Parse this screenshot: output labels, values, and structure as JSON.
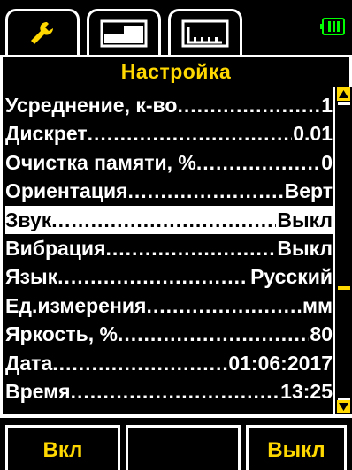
{
  "tabs": [
    {
      "name": "settings",
      "icon": "wrench-icon",
      "active": true
    },
    {
      "name": "display",
      "icon": "bars-display-icon",
      "active": false
    },
    {
      "name": "chart",
      "icon": "histogram-icon",
      "active": false
    }
  ],
  "battery": {
    "icon": "battery-icon",
    "color": "#00ff00"
  },
  "title": "Настройка",
  "menu": [
    {
      "label": "Усреднение, к-во",
      "value": "1"
    },
    {
      "label": "Дискрет",
      "value": "0.01"
    },
    {
      "label": "Очистка памяти, %",
      "value": "0"
    },
    {
      "label": "Ориентация",
      "value": "Верт"
    },
    {
      "label": "Звук",
      "value": "Выкл"
    },
    {
      "label": "Вибрация",
      "value": "Выкл"
    },
    {
      "label": "Язык",
      "value": "Русский"
    },
    {
      "label": "Ед.измерения",
      "value": " мм"
    },
    {
      "label": "Яркость, %",
      "value": "80"
    },
    {
      "label": "Дата",
      "value": "01:06:2017"
    },
    {
      "label": "Время",
      "value": "13:25"
    }
  ],
  "selected_index": 4,
  "scroll": {
    "position": 0.62
  },
  "softkeys": {
    "left": "Вкл",
    "middle": "",
    "right": "Выкл"
  },
  "colors": {
    "accent": "#ffd800",
    "background": "#000000",
    "foreground": "#ffffff"
  }
}
